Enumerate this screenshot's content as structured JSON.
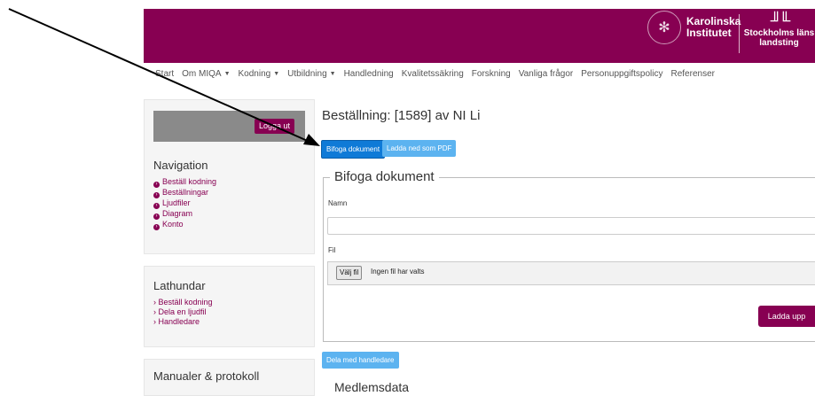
{
  "header": {
    "logo_ki": [
      "Karolinska",
      "Institutet"
    ],
    "logo_sll": [
      "Stockholms läns",
      "landsting"
    ],
    "brand_color": "#870052"
  },
  "topnav": {
    "items": [
      {
        "label": "Start",
        "dropdown": false
      },
      {
        "label": "Om MIQA",
        "dropdown": true
      },
      {
        "label": "Kodning",
        "dropdown": true
      },
      {
        "label": "Utbildning",
        "dropdown": true
      },
      {
        "label": "Handledning",
        "dropdown": false
      },
      {
        "label": "Kvalitetssäkring",
        "dropdown": false
      },
      {
        "label": "Forskning",
        "dropdown": false
      },
      {
        "label": "Vanliga frågor",
        "dropdown": false
      },
      {
        "label": "Personuppgiftspolicy",
        "dropdown": false
      },
      {
        "label": "Referenser",
        "dropdown": false
      }
    ]
  },
  "sidebar": {
    "logout_label": "Logga ut",
    "navigation": {
      "heading": "Navigation",
      "items": [
        "Beställ kodning",
        "Beställningar",
        "Ljudfiler",
        "Diagram",
        "Konto"
      ]
    },
    "lathundar": {
      "heading": "Lathundar",
      "items": [
        "Beställ kodning",
        "Dela en ljudfil",
        "Handledare"
      ]
    },
    "manualer": {
      "heading": "Manualer & protokoll"
    }
  },
  "main": {
    "title": "Beställning: [1589] av NI Li",
    "buttons": {
      "attach": "Bifoga dokument",
      "pdf": "Ladda ned som PDF",
      "share": "Dela med handledare"
    },
    "form": {
      "legend": "Bifoga dokument",
      "name_label": "Namn",
      "name_value": "",
      "file_label": "Fil",
      "file_button": "Välj fil",
      "file_status": "Ingen fil har valts",
      "upload_label": "Ladda upp"
    },
    "next_heading": "Medlemsdata"
  }
}
